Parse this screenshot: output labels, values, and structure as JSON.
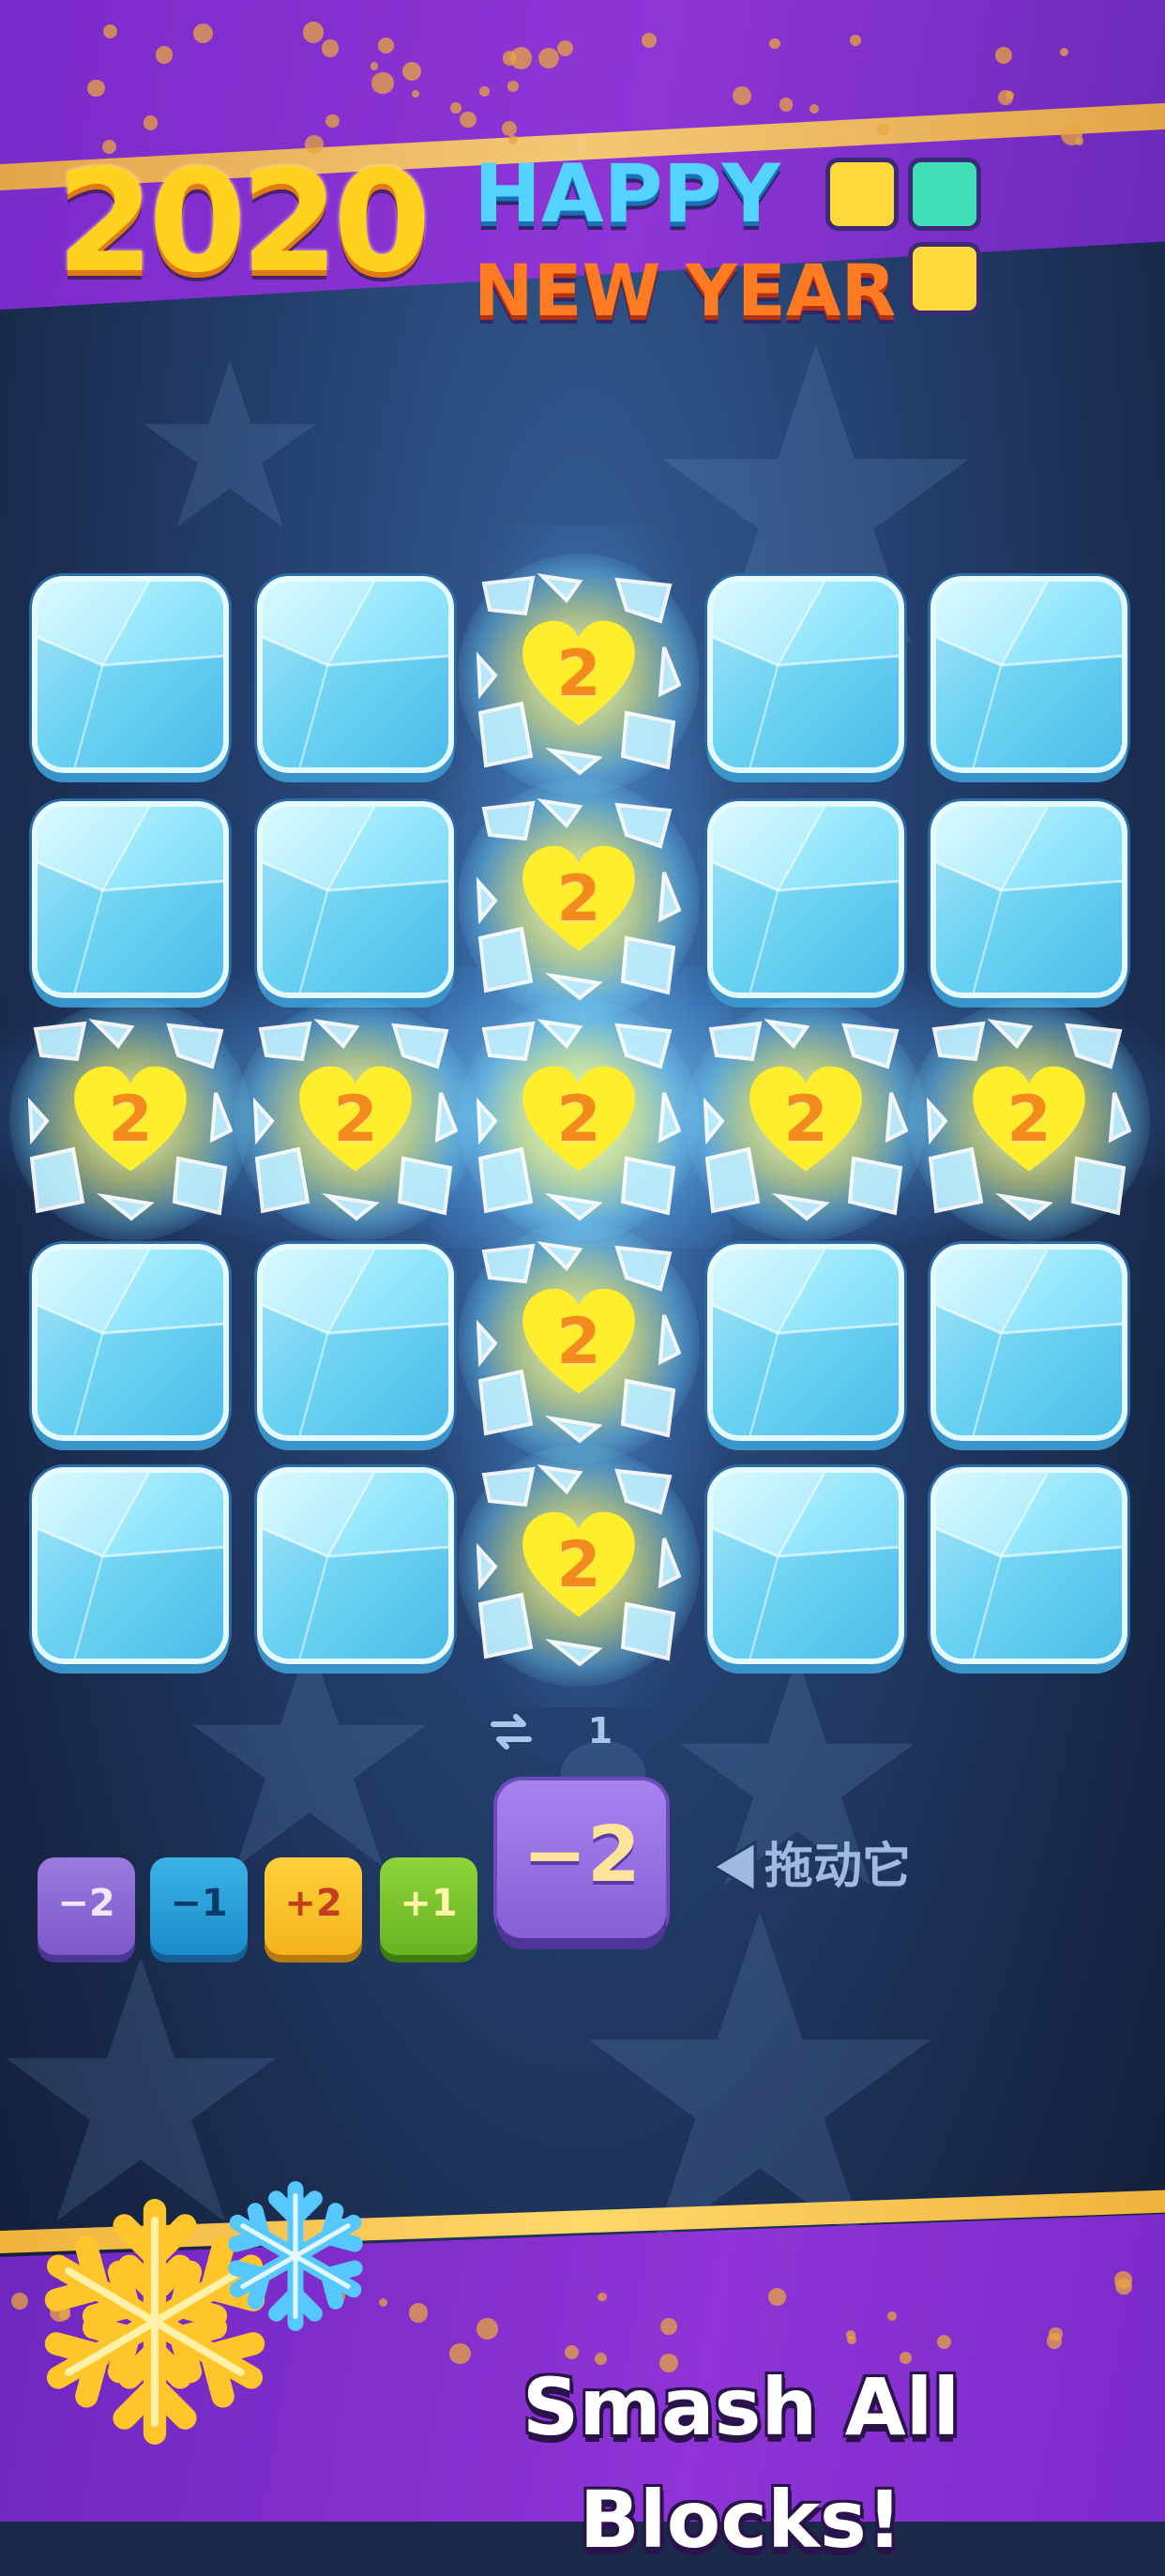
{
  "header": {
    "year": "2020",
    "line1": "HAPPY",
    "line2": "NEW YEAR",
    "logo_colors": [
      "#ffd93b",
      "#3fe0b5",
      "#ffd93b"
    ]
  },
  "board": {
    "rows": 5,
    "cols": 5,
    "cells": [
      [
        "ice",
        "ice",
        "2",
        "ice",
        "ice"
      ],
      [
        "ice",
        "ice",
        "2",
        "ice",
        "ice"
      ],
      [
        "2",
        "2",
        "2",
        "2",
        "2"
      ],
      [
        "ice",
        "ice",
        "2",
        "ice",
        "ice"
      ],
      [
        "ice",
        "ice",
        "2",
        "ice",
        "ice"
      ]
    ]
  },
  "swap": {
    "icon": "swap-arrows-icon",
    "count": "1"
  },
  "tray": {
    "pieces": [
      {
        "label": "−2",
        "color": "purple"
      },
      {
        "label": "−1",
        "color": "blue"
      },
      {
        "label": "+2",
        "color": "yellow"
      },
      {
        "label": "+1",
        "color": "green"
      }
    ],
    "active_piece": "−2",
    "hint": "拖动它"
  },
  "footer": {
    "slogan": "Smash All Blocks!"
  }
}
